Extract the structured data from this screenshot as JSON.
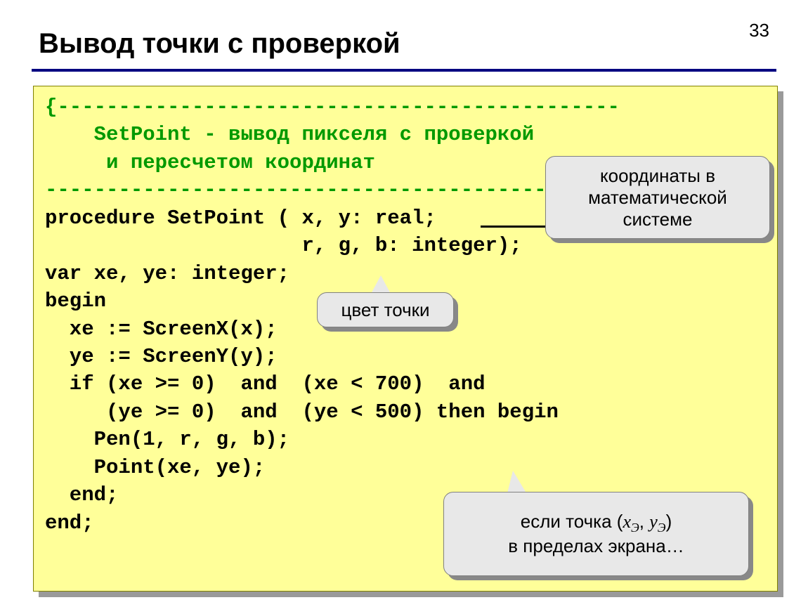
{
  "page_number": "33",
  "title": "Вывод точки с проверкой",
  "code": {
    "c1": "{----------------------------------------------",
    "c2": "    SetPoint - вывод пикселя с проверкой",
    "c3": "     и пересчетом координат",
    "c4": "-----------------------------------------------}",
    "l1": "procedure SetPoint ( x, y: real;",
    "l2": "                     r, g, b: integer);",
    "l3": "var xe, ye: integer;",
    "l4": "begin",
    "l5": "  xe := ScreenX(x);",
    "l6": "  ye := ScreenY(y);",
    "l7": "  if (xe >= 0)  and  (xe < 700)  and",
    "l8": "     (ye >= 0)  and  (ye < 500) then begin",
    "l9": "    Pen(1, r, g, b);",
    "l10": "    Point(xe, ye);",
    "l11": "  end;",
    "l12": "end;"
  },
  "callouts": {
    "coords": "координаты в математической системе",
    "color": "цвет точки",
    "bounds_prefix": "если точка (",
    "bounds_x": "x",
    "bounds_sub": "Э",
    "bounds_sep": ", ",
    "bounds_y": "y",
    "bounds_suffix": ")",
    "bounds_line2": "в пределах экрана…"
  }
}
